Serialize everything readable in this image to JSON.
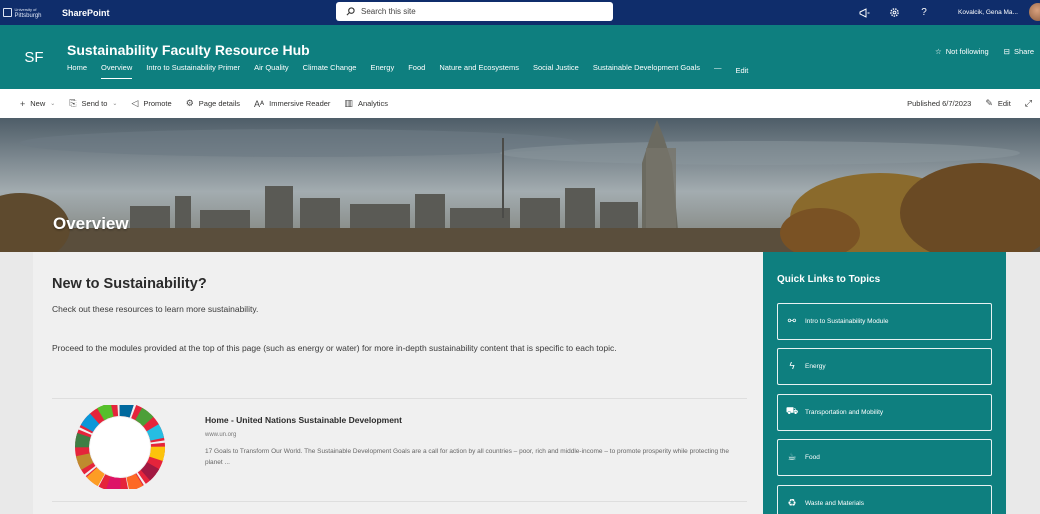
{
  "suitebar": {
    "org_line1": "University of",
    "org_line2": "Pittsburgh",
    "app_name": "SharePoint",
    "search_placeholder": "Search this site",
    "user_name": "Kovalcik, Gena Ma..."
  },
  "site": {
    "logo_initials": "SF",
    "title": "Sustainability Faculty Resource Hub",
    "nav": [
      "Home",
      "Overview",
      "Intro to Sustainability Primer",
      "Air Quality",
      "Climate Change",
      "Energy",
      "Food",
      "Nature and Ecosystems",
      "Social Justice",
      "Sustainable Development Goals",
      "—",
      "Edit"
    ],
    "not_following": "Not following",
    "share": "Share"
  },
  "commandbar": {
    "new": "New",
    "send_to": "Send to",
    "promote": "Promote",
    "page_details": "Page details",
    "immersive_reader": "Immersive Reader",
    "analytics": "Analytics",
    "published": "Published 6/7/2023",
    "edit": "Edit"
  },
  "banner": {
    "title": "Overview"
  },
  "main": {
    "heading": "New to Sustainability?",
    "p1": "Check out these resources to learn more sustainability.",
    "p2": "Proceed to the modules provided at the top of this page (such as energy or water) for more in-depth sustainability content that is specific to each topic.",
    "link": {
      "title": "Home - United Nations Sustainable Development",
      "url": "www.un.org",
      "desc": "17 Goals to Transform Our World. The Sustainable Development Goals are a call for action by all countries – poor, rich and middle-income – to promote prosperity while protecting the planet ..."
    }
  },
  "quicklinks": {
    "heading": "Quick Links to Topics",
    "items": [
      {
        "label": "Intro to Sustainability Module",
        "icon": "link-nodes-icon"
      },
      {
        "label": "Energy",
        "icon": "lightning-icon"
      },
      {
        "label": "Transportation and Mobility",
        "icon": "car-icon"
      },
      {
        "label": "Food",
        "icon": "coffee-cup-icon"
      },
      {
        "label": "Waste and Materials",
        "icon": "recycle-icon"
      }
    ]
  },
  "colors": {
    "suitebar": "#0f2d6b",
    "theme": "#0e7f7f"
  }
}
